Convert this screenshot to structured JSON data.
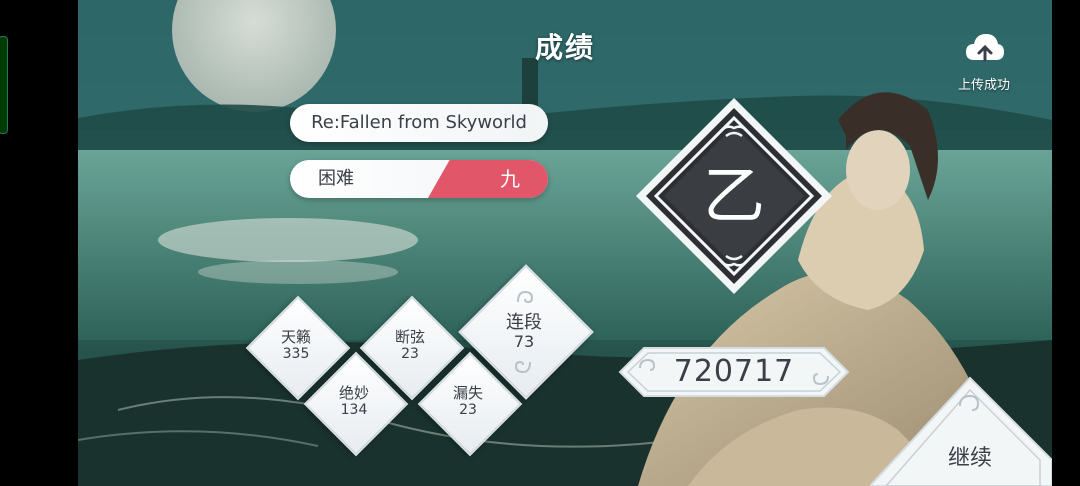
{
  "header": {
    "title": "成绩"
  },
  "upload": {
    "label": "上传成功",
    "icon": "cloud-upload-icon"
  },
  "song": {
    "name": "Re:Fallen from Skyworld"
  },
  "difficulty": {
    "label": "困难",
    "level": "九"
  },
  "stats": {
    "tianlai": {
      "label": "天籁",
      "value": "335"
    },
    "juemiao": {
      "label": "绝妙",
      "value": "134"
    },
    "duanxian": {
      "label": "断弦",
      "value": "23"
    },
    "loushi": {
      "label": "漏失",
      "value": "23"
    },
    "combo": {
      "label": "连段",
      "value": "73"
    }
  },
  "grade": {
    "value": "乙"
  },
  "score": {
    "value": "720717"
  },
  "continue": {
    "label": "继续"
  },
  "colors": {
    "difficulty_accent": "#e2566a",
    "panel": "#ffffff",
    "text": "#3b4048"
  }
}
